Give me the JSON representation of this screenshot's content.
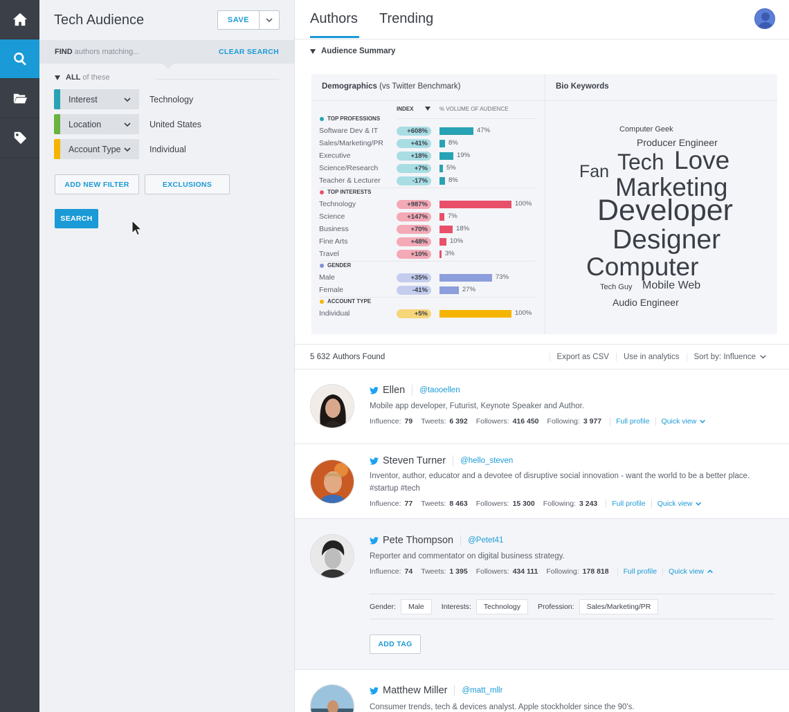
{
  "rail": {
    "items": [
      {
        "icon": "home-icon",
        "active": false
      },
      {
        "icon": "search-icon",
        "active": true
      },
      {
        "icon": "folder-icon",
        "active": false
      },
      {
        "icon": "tag-icon",
        "active": false
      }
    ]
  },
  "panel": {
    "title": "Tech Audience",
    "save_label": "SAVE",
    "find_bold": "FIND",
    "find_text": "authors matching...",
    "clear_label": "CLEAR SEARCH",
    "all_bold": "ALL",
    "all_text": "of these",
    "filters": [
      {
        "label": "Interest",
        "value": "Technology",
        "color": "#27a3b5"
      },
      {
        "label": "Location",
        "value": "United States",
        "color": "#6ab33f"
      },
      {
        "label": "Account Type",
        "value": "Individual",
        "color": "#f5b400"
      }
    ],
    "add_filter_label": "ADD NEW FILTER",
    "exclusions_label": "EXCLUSIONS",
    "search_label": "SEARCH"
  },
  "tabs": {
    "authors": "Authors",
    "trending": "Trending"
  },
  "summary": {
    "title": "Audience Summary",
    "demographics_title": "Demographics",
    "demographics_sub": "(vs Twitter Benchmark)",
    "index_label": "INDEX",
    "volume_label": "% VOLUME OF AUDIENCE",
    "sections": [
      {
        "label": "TOP PROFESSIONS",
        "color": "#27a3b5",
        "pill_color": "#a8dde4",
        "bar_color": "#27a3b5",
        "rows": [
          {
            "name": "Software Dev & IT",
            "index": "+608%",
            "volume": 47,
            "pct": "47%"
          },
          {
            "name": "Sales/Marketing/PR",
            "index": "+41%",
            "volume": 8,
            "pct": "8%"
          },
          {
            "name": "Executive",
            "index": "+18%",
            "volume": 19,
            "pct": "19%"
          },
          {
            "name": "Science/Research",
            "index": "+7%",
            "volume": 5,
            "pct": "5%"
          },
          {
            "name": "Teacher & Lecturer",
            "index": "-17%",
            "volume": 8,
            "pct": "8%"
          }
        ]
      },
      {
        "label": "TOP INTERESTS",
        "color": "#e8506a",
        "pill_color": "#f4a9b6",
        "bar_color": "#e8506a",
        "rows": [
          {
            "name": "Technology",
            "index": "+987%",
            "volume": 100,
            "pct": "100%"
          },
          {
            "name": "Science",
            "index": "+147%",
            "volume": 7,
            "pct": "7%"
          },
          {
            "name": "Business",
            "index": "+70%",
            "volume": 18,
            "pct": "18%"
          },
          {
            "name": "Fine Arts",
            "index": "+48%",
            "volume": 10,
            "pct": "10%"
          },
          {
            "name": "Travel",
            "index": "+10%",
            "volume": 3,
            "pct": "3%"
          }
        ]
      },
      {
        "label": "GENDER",
        "color": "#7d90d4",
        "pill_color": "#c4cdee",
        "bar_color": "#8c9edb",
        "rows": [
          {
            "name": "Male",
            "index": "+35%",
            "volume": 73,
            "pct": "73%"
          },
          {
            "name": "Female",
            "index": "-41%",
            "volume": 27,
            "pct": "27%"
          }
        ]
      },
      {
        "label": "ACCOUNT TYPE",
        "color": "#f5b400",
        "pill_color": "#f7d679",
        "bar_color": "#f5b400",
        "rows": [
          {
            "name": "Individual",
            "index": "+5%",
            "volume": 100,
            "pct": "100%"
          }
        ]
      }
    ],
    "bio_title": "Bio Keywords",
    "keywords": [
      {
        "text": "Computer Geek",
        "weight": 1
      },
      {
        "text": "Producer Engineer",
        "weight": 2
      },
      {
        "text": "Fan",
        "weight": 4
      },
      {
        "text": "Tech",
        "weight": 5
      },
      {
        "text": "Love",
        "weight": 6
      },
      {
        "text": "Marketing",
        "weight": 6
      },
      {
        "text": "Developer",
        "weight": 8
      },
      {
        "text": "Designer",
        "weight": 7
      },
      {
        "text": "Computer",
        "weight": 6
      },
      {
        "text": "Tech Guy",
        "weight": 1
      },
      {
        "text": "Mobile Web",
        "weight": 3
      },
      {
        "text": "Audio Engineer",
        "weight": 2
      }
    ]
  },
  "results": {
    "count": "5 632",
    "count_label": "Authors Found",
    "export_label": "Export as CSV",
    "analytics_label": "Use in analytics",
    "sort_label": "Sort by: Influence"
  },
  "labels": {
    "influence": "Influence:",
    "tweets": "Tweets:",
    "followers": "Followers:",
    "following": "Following:",
    "full_profile": "Full profile",
    "quick_view": "Quick view",
    "gender": "Gender:",
    "interests": "Interests:",
    "profession": "Profession:",
    "add_tag": "ADD TAG"
  },
  "authors": [
    {
      "name": "Ellen",
      "handle": "@taooellen",
      "bio": "Mobile app developer, Futurist, Keynote Speaker and Author.",
      "influence": "79",
      "tweets": "6 392",
      "followers": "416 450",
      "following": "3 977"
    },
    {
      "name": "Steven Turner",
      "handle": "@hello_steven",
      "bio": "Inventor, author, educator and a devotee of disruptive social innovation - want the world to be a better place. #startup #tech",
      "influence": "77",
      "tweets": "8 463",
      "followers": "15 300",
      "following": "3 243"
    },
    {
      "name": "Pete Thompson",
      "handle": "@Petet41",
      "bio": "Reporter and commentator on digital business strategy.",
      "influence": "74",
      "tweets": "1 395",
      "followers": "434 111",
      "following": "178 818",
      "gender": "Male",
      "interests": "Technology",
      "profession": "Sales/Marketing/PR"
    },
    {
      "name": "Matthew Miller",
      "handle": "@matt_mllr",
      "bio": "Consumer trends, tech & devices analyst. Apple stockholder since the 90's."
    }
  ]
}
